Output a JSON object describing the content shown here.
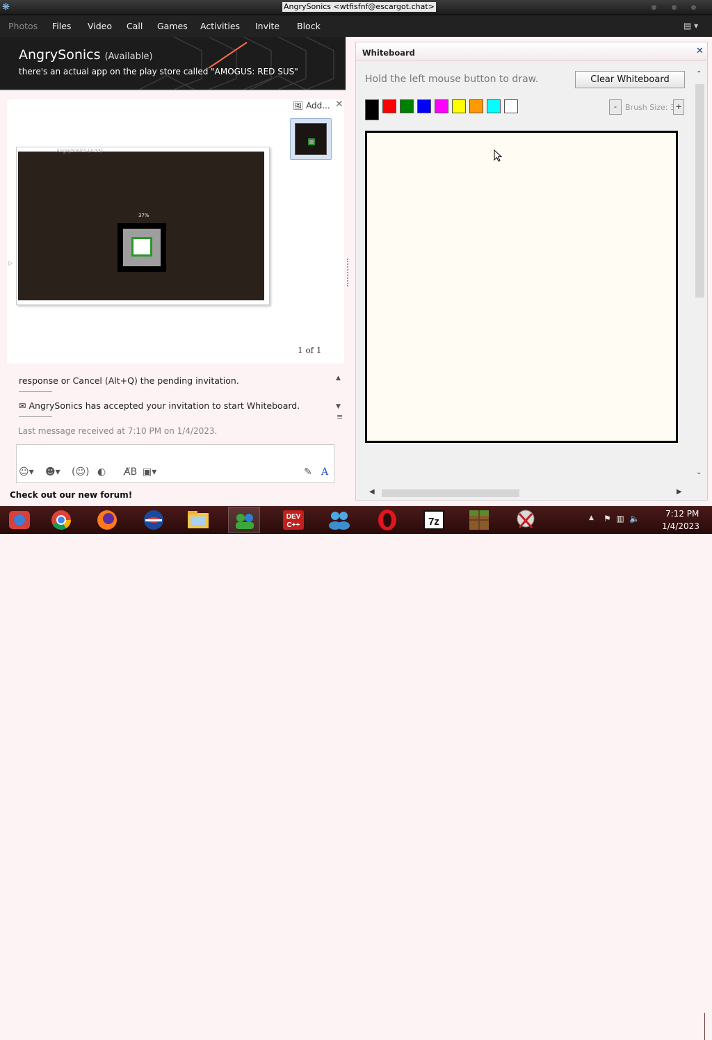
{
  "window": {
    "title": "AngrySonics <wtfisfnf@escargot.chat>"
  },
  "menu": {
    "items": [
      "Photos",
      "Files",
      "Video",
      "Call",
      "Games",
      "Activities",
      "Invite",
      "Block"
    ]
  },
  "profile": {
    "name": "AngrySonics",
    "status": "(Available)",
    "message": "there's an actual app on the play store called \"AMOGUS: RED SUS\""
  },
  "photos": {
    "add_label": "Add...",
    "page_count": "1 of 1",
    "photo_percent": "37%",
    "photo_title": "AngrySonics (7:33)"
  },
  "chat": {
    "line1": "response or Cancel (Alt+Q) the pending invitation.",
    "line2": "AngrySonics has accepted your invitation to start Whiteboard.",
    "last_message": "Last message received at 7:10 PM on 1/4/2023."
  },
  "footer": {
    "forum": "Check out our new forum!"
  },
  "whiteboard": {
    "title": "Whiteboard",
    "hint": "Hold the left mouse button to draw.",
    "clear_label": "Clear Whiteboard",
    "brush_label": "Brush Size: 3",
    "minus": "-",
    "plus": "+",
    "swatches": [
      "#000000",
      "#ff0000",
      "#008000",
      "#0000ff",
      "#ff00ff",
      "#ffff00",
      "#ff9900",
      "#00ffff",
      "#ffffff"
    ]
  },
  "clock": {
    "time": "7:12 PM",
    "date": "1/4/2023"
  },
  "taskbar": {
    "apps": [
      "Photos viewer",
      "Chrome",
      "Firefox",
      "Opera GX",
      "File Explorer",
      "Escargot",
      "Dev-C++",
      "Messenger",
      "Opera",
      "7-Zip",
      "Minecraft",
      "Snipping Tool"
    ]
  }
}
